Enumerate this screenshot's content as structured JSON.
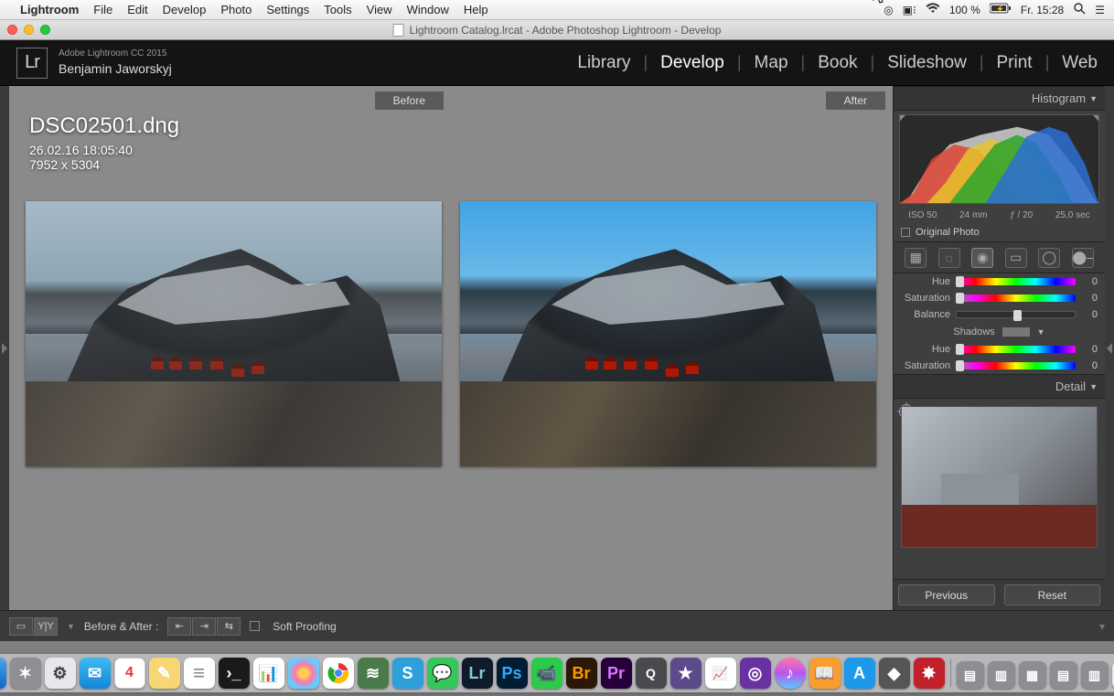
{
  "menubar": {
    "app": "Lightroom",
    "items": [
      "File",
      "Edit",
      "Develop",
      "Photo",
      "Settings",
      "Tools",
      "View",
      "Window",
      "Help"
    ],
    "battery": "100 %",
    "clock": "Fr. 15:28"
  },
  "window": {
    "title": "Lightroom Catalog.lrcat - Adobe Photoshop Lightroom - Develop"
  },
  "identity": {
    "version": "Adobe Lightroom CC 2015",
    "user": "Benjamin Jaworskyj"
  },
  "modules": [
    "Library",
    "Develop",
    "Map",
    "Book",
    "Slideshow",
    "Print",
    "Web"
  ],
  "modules_active": "Develop",
  "before_after": {
    "before": "Before",
    "after": "After"
  },
  "file": {
    "name": "DSC02501.dng",
    "date": "26.02.16 18:05:40",
    "dim": "7952 x 5304"
  },
  "histogram": {
    "title": "Histogram",
    "iso": "ISO 50",
    "focal": "24 mm",
    "aperture": "ƒ / 20",
    "shutter": "25,0 sec",
    "original": "Original Photo"
  },
  "split": {
    "hue": "Hue",
    "hue_val": "0",
    "sat": "Saturation",
    "sat_val": "0",
    "balance": "Balance",
    "balance_val": "0",
    "shadows": "Shadows",
    "hue2": "Hue",
    "hue2_val": "0",
    "sat2": "Saturation",
    "sat2_val": "0"
  },
  "detail": {
    "title": "Detail"
  },
  "toolbar": {
    "ba_label": "Before & After :",
    "soft_proof": "Soft Proofing"
  },
  "bottom_right": {
    "prev": "Previous",
    "reset": "Reset"
  }
}
